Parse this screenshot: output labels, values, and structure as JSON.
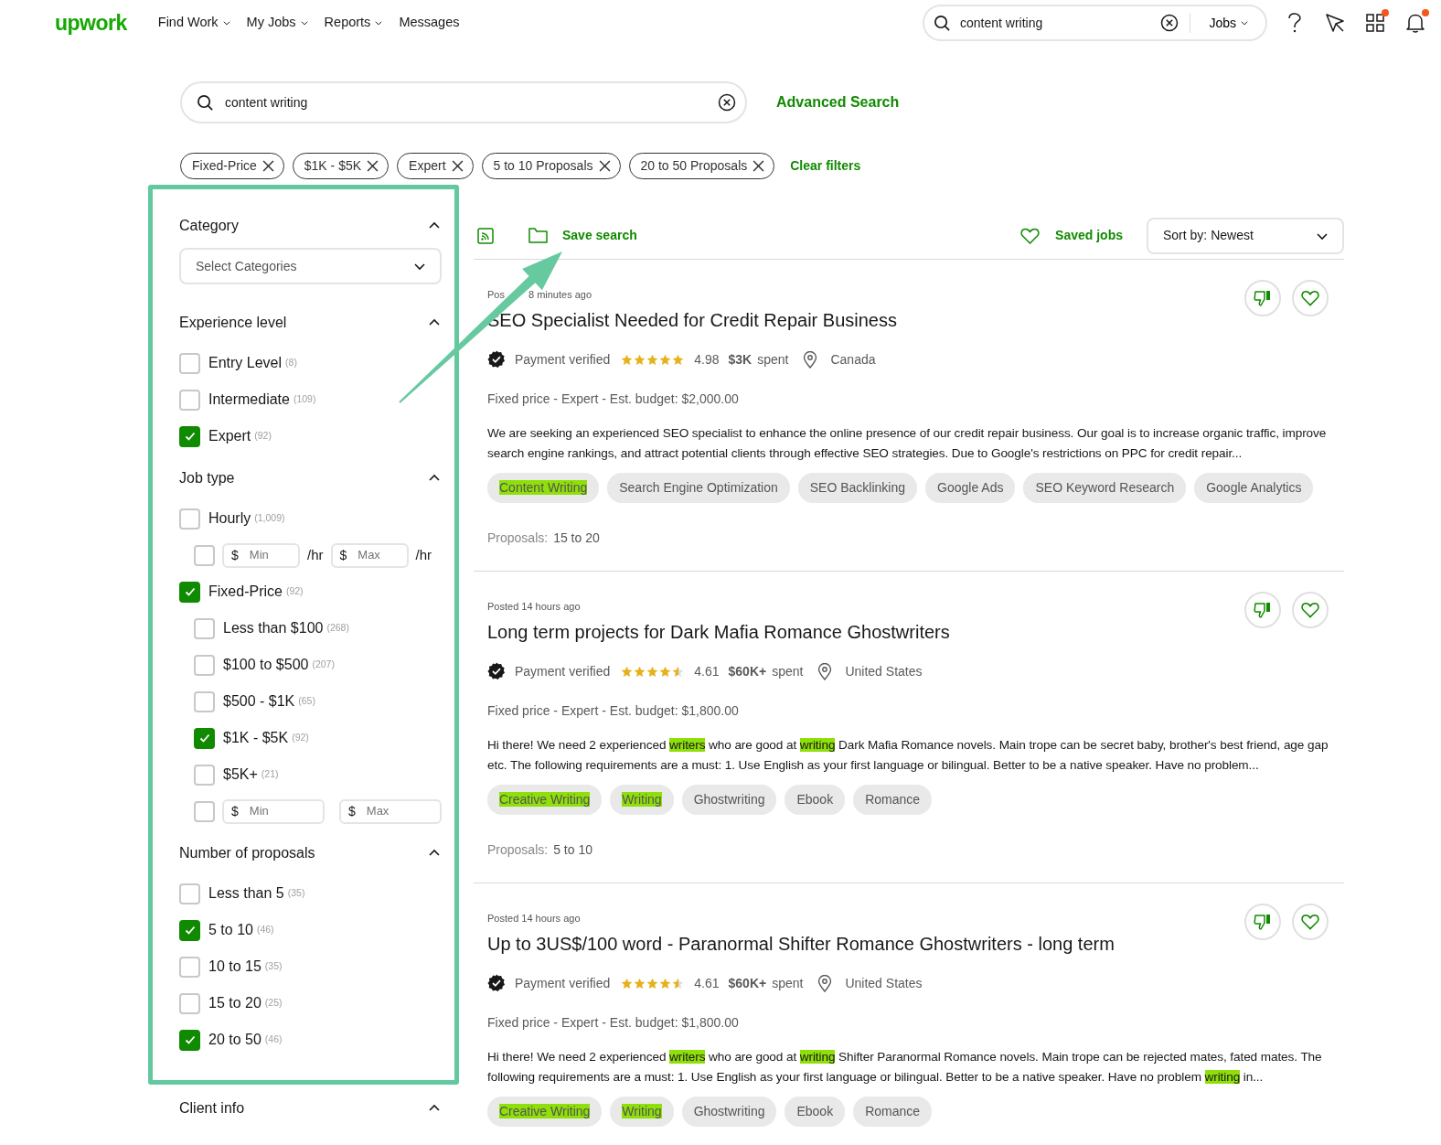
{
  "nav": {
    "logo": "upwork",
    "menu": [
      {
        "label": "Find Work",
        "dropdown": true
      },
      {
        "label": "My Jobs",
        "dropdown": true
      },
      {
        "label": "Reports",
        "dropdown": true
      },
      {
        "label": "Messages",
        "dropdown": false
      }
    ],
    "search": {
      "value": "content writing",
      "scope": "Jobs"
    },
    "apps_dot": true,
    "bell_dot": true
  },
  "search": {
    "value": "content writing",
    "advanced_link": "Advanced Search"
  },
  "filters": [
    {
      "label": "Fixed-Price"
    },
    {
      "label": "$1K - $5K"
    },
    {
      "label": "Expert"
    },
    {
      "label": "5 to 10 Proposals"
    },
    {
      "label": "20 to 50 Proposals"
    }
  ],
  "clear_filters": "Clear filters",
  "sidebar": {
    "sections": [
      {
        "title": "Category",
        "expanded": true,
        "kind": "select",
        "placeholder": "Select Categories"
      },
      {
        "title": "Experience level",
        "expanded": true,
        "kind": "options",
        "items": [
          {
            "kind": "option",
            "label": "Entry Level",
            "count": "(8)",
            "checked": false
          },
          {
            "kind": "option",
            "label": "Intermediate",
            "count": "(109)",
            "checked": false
          },
          {
            "kind": "option",
            "label": "Expert",
            "count": "(92)",
            "checked": true
          }
        ]
      },
      {
        "title": "Job type",
        "expanded": true,
        "kind": "options",
        "items": [
          {
            "kind": "option",
            "label": "Hourly",
            "count": "(1,009)",
            "checked": false,
            "children": [
              {
                "kind": "range",
                "checked": false,
                "min": {
                  "prefix": "$",
                  "placeholder": "Min",
                  "suffix": "/hr"
                },
                "max": {
                  "prefix": "$",
                  "placeholder": "Max",
                  "suffix": "/hr"
                }
              }
            ]
          },
          {
            "kind": "option",
            "label": "Fixed-Price",
            "count": "(92)",
            "checked": true,
            "children": [
              {
                "kind": "option",
                "label": "Less than $100",
                "count": "(268)",
                "checked": false
              },
              {
                "kind": "option",
                "label": "$100 to $500",
                "count": "(207)",
                "checked": false
              },
              {
                "kind": "option",
                "label": "$500 - $1K",
                "count": "(65)",
                "checked": false
              },
              {
                "kind": "option",
                "label": "$1K - $5K",
                "count": "(92)",
                "checked": true
              },
              {
                "kind": "option",
                "label": "$5K+",
                "count": "(21)",
                "checked": false
              },
              {
                "kind": "range",
                "checked": false,
                "min": {
                  "prefix": "$",
                  "placeholder": "Min"
                },
                "max": {
                  "prefix": "$",
                  "placeholder": "Max"
                }
              }
            ]
          }
        ]
      },
      {
        "title": "Number of proposals",
        "expanded": true,
        "kind": "options",
        "items": [
          {
            "kind": "option",
            "label": "Less than 5",
            "count": "(35)",
            "checked": false
          },
          {
            "kind": "option",
            "label": "5 to 10",
            "count": "(46)",
            "checked": true
          },
          {
            "kind": "option",
            "label": "10 to 15",
            "count": "(35)",
            "checked": false
          },
          {
            "kind": "option",
            "label": "15 to 20",
            "count": "(25)",
            "checked": false
          },
          {
            "kind": "option",
            "label": "20 to 50",
            "count": "(46)",
            "checked": true
          }
        ]
      },
      {
        "title": "Client info",
        "expanded": true,
        "kind": "options"
      }
    ]
  },
  "toolbar": {
    "save_search": "Save search",
    "saved_jobs": "Saved jobs",
    "sort": "Sort by: Newest"
  },
  "jobs": [
    {
      "posted": "Pos",
      "posted_after": "8 minutes ago",
      "title": "SEO Specialist Needed for Credit Repair Business",
      "payment": "Payment verified",
      "stars": 5,
      "rating": "4.98",
      "spent": "$3K",
      "spent_label": "spent",
      "location": "Canada",
      "meta": "Fixed price - Expert - Est. budget: $2,000.00",
      "description": "We are seeking an experienced SEO specialist to enhance the online presence of our credit repair business. Our goal is to increase organic traffic, improve search engine rankings, and attract potential clients through effective SEO strategies. Due to Google's restrictions on PPC for credit repair...",
      "tags": [
        {
          "label": "Content Writing",
          "highlighted": true
        },
        {
          "label": "Search Engine Optimization",
          "highlighted": false
        },
        {
          "label": "SEO Backlinking",
          "highlighted": false
        },
        {
          "label": "Google Ads",
          "highlighted": false
        },
        {
          "label": "SEO Keyword Research",
          "highlighted": false
        },
        {
          "label": "Google Analytics",
          "highlighted": false
        }
      ],
      "proposals_label": "Proposals:",
      "proposals": "15 to 20"
    },
    {
      "posted": "Posted 14 hours ago",
      "title": "Long term projects for Dark Mafia Romance Ghostwriters",
      "payment": "Payment verified",
      "stars": 4.5,
      "rating": "4.61",
      "spent": "$60K+",
      "spent_label": "spent",
      "location": "United States",
      "meta": "Fixed price - Expert - Est. budget: $1,800.00",
      "description": "Hi there! We need 2 experienced **writers** who are good at **writing** Dark Mafia Romance novels. Main trope can be secret baby, brother's best friend, age gap etc. The following requirements are a must: 1. Use English as your first language or bilingual. Better to be a native speaker. Have no problem...",
      "tags": [
        {
          "label": "Creative Writing",
          "highlighted": true
        },
        {
          "label": "Writing",
          "highlighted": true
        },
        {
          "label": "Ghostwriting",
          "highlighted": false
        },
        {
          "label": "Ebook",
          "highlighted": false
        },
        {
          "label": "Romance",
          "highlighted": false
        }
      ],
      "proposals_label": "Proposals:",
      "proposals": "5 to 10"
    },
    {
      "posted": "Posted 14 hours ago",
      "title": "Up to 3US$/100 word - Paranormal Shifter Romance Ghostwriters - long term",
      "payment": "Payment verified",
      "stars": 4.5,
      "rating": "4.61",
      "spent": "$60K+",
      "spent_label": "spent",
      "location": "United States",
      "meta": "Fixed price - Expert - Est. budget: $1,800.00",
      "description": "Hi there! We need 2 experienced **writers** who are good at **writing** Shifter Paranormal Romance novels. Main trope can be rejected mates, fated mates. The following requirements are a must: 1. Use English as your first language or bilingual. Better to be a native speaker. Have no problem **writing** in...",
      "tags": [
        {
          "label": "Creative Writing",
          "highlighted": true
        },
        {
          "label": "Writing",
          "highlighted": true
        },
        {
          "label": "Ghostwriting",
          "highlighted": false
        },
        {
          "label": "Ebook",
          "highlighted": false
        },
        {
          "label": "Romance",
          "highlighted": false
        }
      ]
    }
  ],
  "annotation": {
    "frame": true,
    "arrow": true
  }
}
